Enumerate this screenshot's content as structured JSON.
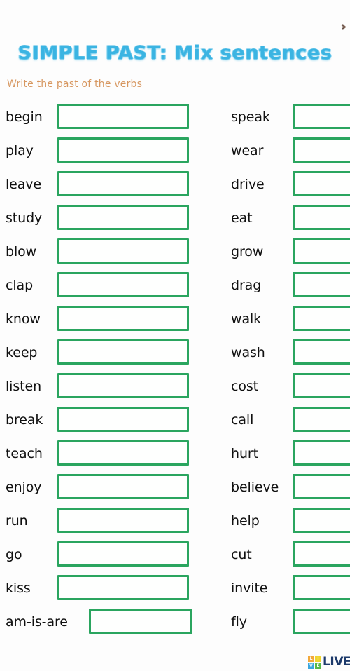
{
  "worksheet": {
    "title": "SIMPLE PAST: Mix sentences",
    "instruction": "Write the past of the verbs",
    "title_color": "#3bb4e2",
    "instruction_color": "#d79760",
    "box_border_color": "#2aa55f",
    "background_color": "#fdfdfd"
  },
  "columns": {
    "left": [
      {
        "verb": "begin",
        "answer": ""
      },
      {
        "verb": "play",
        "answer": ""
      },
      {
        "verb": "leave",
        "answer": ""
      },
      {
        "verb": "study",
        "answer": ""
      },
      {
        "verb": "blow",
        "answer": ""
      },
      {
        "verb": "clap",
        "answer": ""
      },
      {
        "verb": "know",
        "answer": ""
      },
      {
        "verb": "keep",
        "answer": ""
      },
      {
        "verb": "listen",
        "answer": ""
      },
      {
        "verb": "break",
        "answer": ""
      },
      {
        "verb": "teach",
        "answer": ""
      },
      {
        "verb": "enjoy",
        "answer": ""
      },
      {
        "verb": "run",
        "answer": ""
      },
      {
        "verb": "go",
        "answer": ""
      },
      {
        "verb": "kiss",
        "answer": ""
      },
      {
        "verb": "am-is-are",
        "answer": ""
      }
    ],
    "right": [
      {
        "verb": "speak",
        "answer": ""
      },
      {
        "verb": "wear",
        "answer": ""
      },
      {
        "verb": "drive",
        "answer": ""
      },
      {
        "verb": "eat",
        "answer": ""
      },
      {
        "verb": "grow",
        "answer": ""
      },
      {
        "verb": "drag",
        "answer": ""
      },
      {
        "verb": "walk",
        "answer": ""
      },
      {
        "verb": "wash",
        "answer": ""
      },
      {
        "verb": "cost",
        "answer": ""
      },
      {
        "verb": "call",
        "answer": ""
      },
      {
        "verb": "hurt",
        "answer": ""
      },
      {
        "verb": "believe",
        "answer": ""
      },
      {
        "verb": "help",
        "answer": ""
      },
      {
        "verb": "cut",
        "answer": ""
      },
      {
        "verb": "invite",
        "answer": ""
      },
      {
        "verb": "fly",
        "answer": ""
      }
    ]
  },
  "footer": {
    "logo_squares": [
      "L",
      "I",
      "V",
      "E"
    ],
    "logo_text": "LIVE"
  }
}
